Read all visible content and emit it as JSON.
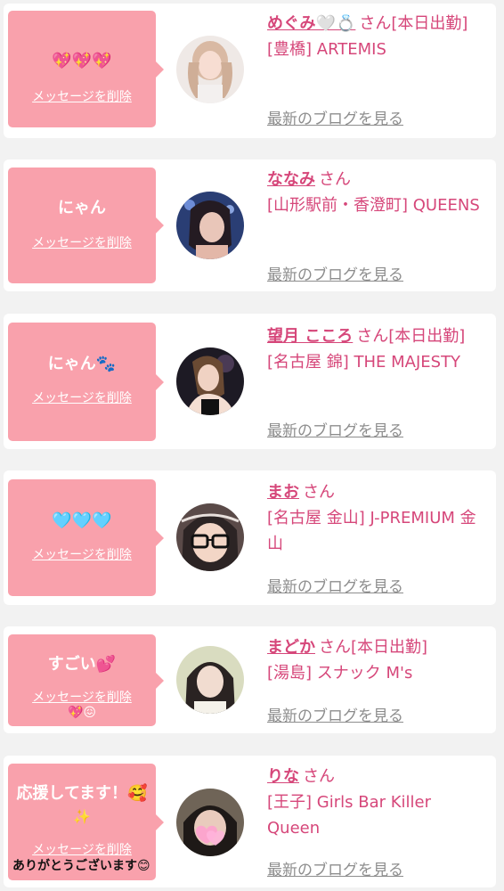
{
  "common": {
    "delete_label": "メッセージを削除",
    "san": "さん",
    "blog_label": "最新のブログを見る"
  },
  "items": [
    {
      "message": "💖💖💖",
      "name": "めぐみ🤍💍",
      "status": "[本日出勤]",
      "shop": "[豊橋] ARTEMIS",
      "avatar_icon": "avatar-photo"
    },
    {
      "message": "にゃん",
      "name": "ななみ",
      "status": "",
      "shop": "[山形駅前・香澄町] QUEENS",
      "avatar_icon": "avatar-photo"
    },
    {
      "message": "にゃん🐾",
      "name": "望月 こころ",
      "status": "[本日出勤]",
      "shop": "[名古屋 錦] THE MAJESTY",
      "avatar_icon": "avatar-photo"
    },
    {
      "message": "🩵🩵🩵",
      "name": "まお",
      "status": "",
      "shop": "[名古屋 金山] J-PREMIUM 金山",
      "avatar_icon": "avatar-photo"
    },
    {
      "message": "すごい💕",
      "message_extra": "💖😖",
      "name": "まどか",
      "status": "[本日出勤]",
      "shop": "[湯島] スナック M's",
      "avatar_icon": "avatar-photo"
    },
    {
      "message": "応援してます！🥰",
      "message_line2": "✨",
      "overlay_text": "ありがとうございます😊",
      "name": "りな",
      "status": "",
      "shop": "[王子] Girls Bar Killer Queen",
      "avatar_icon": "avatar-photo"
    }
  ],
  "colors": {
    "bubble": "#f9a1ac",
    "accent": "#d6477a",
    "muted": "#8d8d8d",
    "background": "#f2f2f2"
  }
}
